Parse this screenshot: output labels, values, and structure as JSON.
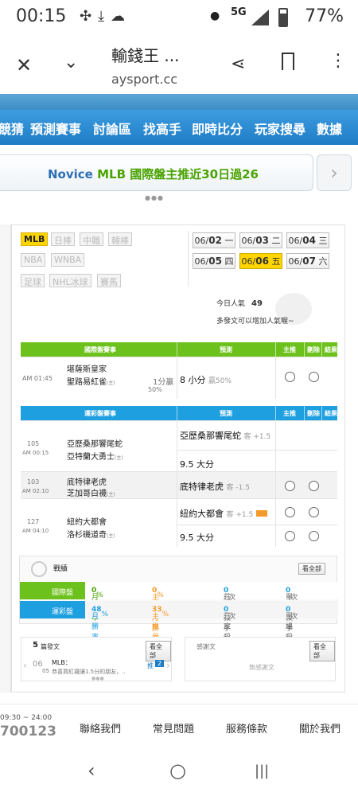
{
  "status": {
    "time": "00:15",
    "network": "5G",
    "battery": "77%",
    "battery_level": 0.77
  },
  "browser": {
    "title": "輸錢王 ...",
    "url": "aysport.cc"
  },
  "nav": {
    "items": [
      "競猜",
      "預測賽事",
      "討論區",
      "找高手",
      "即時比分",
      "玩家搜尋",
      "數據"
    ]
  },
  "banner": {
    "prefix": "Novice ",
    "highlight": "MLB",
    "suffix": " 國際盤主推近30日過26"
  },
  "sports": {
    "active": "MLB",
    "others_row1": [
      "日棒",
      "中職",
      "韓棒"
    ],
    "row2": [
      "NBA",
      "WNBA"
    ],
    "row3": [
      "足球",
      "NHL冰球",
      "賽馬"
    ]
  },
  "dates": [
    {
      "md": "06/",
      "d": "02",
      "w": "一"
    },
    {
      "md": "06/",
      "d": "03",
      "w": "二"
    },
    {
      "md": "06/",
      "d": "04",
      "w": "三"
    },
    {
      "md": "06/",
      "d": "05",
      "w": "四"
    },
    {
      "md": "06/",
      "d": "06",
      "w": "五"
    },
    {
      "md": "06/",
      "d": "07",
      "w": "六"
    }
  ],
  "popularity": {
    "label": "今日人氣",
    "value": "49",
    "note": "多發文可以增加人氣喔~"
  },
  "intl": {
    "header": {
      "event": "國際盤賽事",
      "predict": "預測",
      "main": "主推",
      "delete": "刪除",
      "result": "結果"
    },
    "row": {
      "time": "AM 01:45",
      "team1": "堪薩斯皇家",
      "team2": "聖路易紅雀",
      "host": "(主)",
      "line1": "1分贏",
      "line2": "50%",
      "pick": "8 小分",
      "pick_note": "贏50%"
    }
  },
  "sporttable": {
    "header": {
      "event": "運彩盤賽事",
      "predict": "預測",
      "main": "主推",
      "delete": "刪除",
      "result": "結果"
    },
    "rows": [
      {
        "no": "105",
        "time": "AM 00:15",
        "team1": "亞歷桑那響尾蛇",
        "team2": "亞特蘭大勇士",
        "host": "(主)",
        "pick1": "亞歷桑那響尾蛇",
        "pick1_note": "客 +1.5",
        "pick2": "9.5 大分"
      },
      {
        "no": "103",
        "time": "AM 02:10",
        "team1": "底特律老虎",
        "team2": "芝加哥白襪",
        "host": "(主)",
        "pick1": "底特律老虎",
        "pick1_note": "客 -1.5"
      },
      {
        "no": "127",
        "time": "AM 04:10",
        "team1": "紐約大都會",
        "team2": "洛杉磯道奇",
        "host": "(主)",
        "pick1": "紐約大都會",
        "pick1_note": "客 +1.5",
        "pick2": "9.5 大分"
      }
    ]
  },
  "record": {
    "title": "戰績",
    "all": "看全部",
    "intl": {
      "label": "國際盤",
      "win": "月勝率",
      "win_v": "0",
      "main": "主推月勝率",
      "main_v": "0",
      "farm": "莊家殺手",
      "farm_v": "0",
      "single": "單場殺手",
      "single_v": "0",
      "pct": "%",
      "times": "次"
    },
    "sport": {
      "label": "運彩盤",
      "win": "月勝率",
      "win_v": "48",
      "main": "主推月勝率",
      "main_v": "33",
      "farm": "莊家殺手",
      "farm_v": "0",
      "single": "單場殺手",
      "single_v": "0",
      "pct": "%",
      "times": "次"
    }
  },
  "posts": {
    "count": "5",
    "label": "篇發文",
    "all": "看全部",
    "date1": "06",
    "date2": "05",
    "topic": "MLB：",
    "snippet": "恭喜買紅襪讓1.5分的朋友，..",
    "push": "推",
    "push_n": "2"
  },
  "thanks": {
    "title": "感謝文",
    "all": "看全部",
    "empty": "無感謝文"
  },
  "footer": {
    "hours": "09:30 ~ 24:00",
    "phone": "700123",
    "links": [
      "聯絡我們",
      "常見問題",
      "服務條款",
      "關於我們"
    ]
  }
}
